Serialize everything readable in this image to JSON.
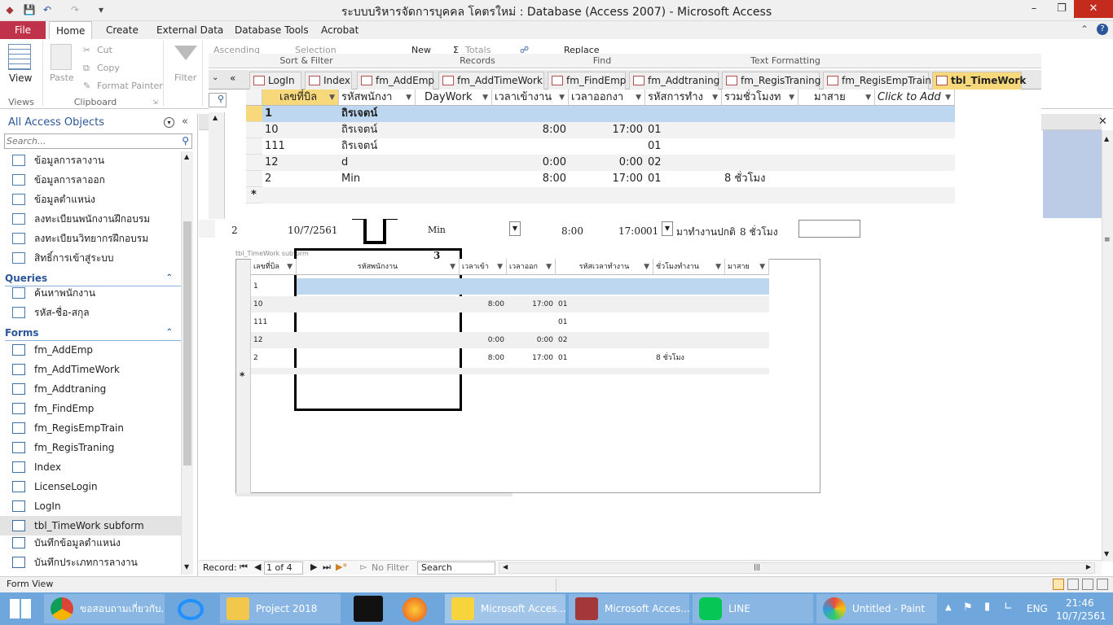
{
  "window": {
    "title": "ระบบบริหารจัดการบุคคล โคตรใหม่ : Database (Access 2007)  -  Microsoft Access",
    "minimize": "–",
    "restore": "❐",
    "close": "✕"
  },
  "ribbon_tabs": [
    "File",
    "Home",
    "Create",
    "External Data",
    "Database Tools",
    "Acrobat"
  ],
  "ribbon": {
    "view_label": "View",
    "paste_label": "Paste",
    "cut_label": "Cut",
    "copy_label": "Copy",
    "format_painter_label": "Format Painter",
    "filter_label": "Filter",
    "ascending_label": "Ascending",
    "selection_label": "Selection",
    "new_label": "New",
    "totals_label": "Totals",
    "replace_label": "Replace",
    "groups": {
      "views": "Views",
      "clipboard": "Clipboard",
      "sort_filter": "Sort & Filter",
      "records": "Records",
      "find": "Find",
      "text_formatting": "Text Formatting"
    }
  },
  "doc_tabs": [
    "LogIn",
    "Index",
    "fm_AddEmp",
    "fm_AddTimeWork",
    "fm_FindEmp",
    "fm_Addtraning",
    "fm_RegisTraning",
    "fm_RegisEmpTrain",
    "tbl_TimeWork"
  ],
  "datasheet": {
    "headers": [
      "เลขที่บิล",
      "รหัสพนักงา",
      "DayWork",
      "เวลาเข้างาน",
      "เวลาออกงา",
      "รหัสการทำง",
      "รวมชั่วโมงท",
      "มาสาย",
      "Click to Add"
    ],
    "rows": [
      [
        "1",
        "ถิรเจตน์",
        "",
        "",
        "",
        "",
        "",
        "",
        ""
      ],
      [
        "10",
        "ถิรเจตน์",
        "",
        "8:00",
        "17:00",
        "01",
        "",
        "",
        ""
      ],
      [
        "111",
        "ถิรเจตน์",
        "",
        "",
        "",
        "01",
        "",
        "",
        ""
      ],
      [
        "12",
        "d",
        "",
        "0:00",
        "0:00",
        "02",
        "",
        "",
        ""
      ],
      [
        "2",
        "Min",
        "",
        "8:00",
        "17:00",
        "01",
        "8 ชั่วโมง",
        "",
        ""
      ]
    ],
    "new_row_marker": "*"
  },
  "form_row": {
    "id": "2",
    "date": "10/7/2561",
    "emp": "Min",
    "time_in": "8:00",
    "time_out": "17:00",
    "code": "01",
    "status": "มาทำงานปกติ",
    "hours": "8 ชั่วโมง"
  },
  "annotation_number": "3",
  "subform": {
    "caption": "tbl_TimeWork subform",
    "headers": [
      "เลขที่บิล",
      "รหัสพนักงาน",
      "เวลาเข้า",
      "เวลาออก",
      "รหัสเวลาทำงาน",
      "ชั่วโมงทำงาน",
      "มาสาย"
    ],
    "rows": [
      [
        "1",
        "",
        "",
        "",
        "",
        "",
        ""
      ],
      [
        "10",
        "",
        "8:00",
        "17:00",
        "01",
        "",
        ""
      ],
      [
        "111",
        "",
        "",
        "",
        "01",
        "",
        ""
      ],
      [
        "12",
        "",
        "0:00",
        "0:00",
        "02",
        "",
        ""
      ],
      [
        "2",
        "",
        "8:00",
        "17:00",
        "01",
        "8 ชั่วโมง",
        ""
      ]
    ],
    "new_row_marker": "*"
  },
  "nav": {
    "header": "All Access Objects",
    "search_placeholder": "Search...",
    "table_items": [
      "ข้อมูลการลางาน",
      "ข้อมูลการลาออก",
      "ข้อมูลตำแหน่ง",
      "ลงทะเบียนพนักงานฝึกอบรม",
      "ลงทะเบียนวิทยากรฝึกอบรม",
      "สิทธิ์การเข้าสู่ระบบ"
    ],
    "queries_label": "Queries",
    "query_items": [
      "ค้นหาพนักงาน",
      "รหัส-ชื่อ-สกุล"
    ],
    "forms_label": "Forms",
    "form_items": [
      "fm_AddEmp",
      "fm_AddTimeWork",
      "fm_Addtraning",
      "fm_FindEmp",
      "fm_RegisEmpTrain",
      "fm_RegisTraning",
      "Index",
      "LicenseLogin",
      "LogIn",
      "tbl_TimeWork subform",
      "บันทึกข้อมูลตำแหน่ง",
      "บันทึกประเภทการลางาน"
    ]
  },
  "record_nav": {
    "label": "Record:",
    "position": "1 of 4",
    "filter": "No Filter",
    "search": "Search"
  },
  "status_bar": {
    "mode": "Form View"
  },
  "taskbar": {
    "items": [
      "ขอสอบถามเกี่ยวกับ...",
      "Project 2018",
      "Microsoft Acces...",
      "Microsoft Acces...",
      "LINE",
      "Untitled - Paint"
    ],
    "language": "ENG",
    "time": "21:46",
    "date": "10/7/2561"
  },
  "colors": {
    "file_tab": "#c0324a",
    "accent_blue": "#2b579a",
    "active_tab": "#f7d87a",
    "selected_row": "#bdd7f0",
    "taskbar": "#6fa7dc",
    "close_button": "#c42b1c"
  }
}
